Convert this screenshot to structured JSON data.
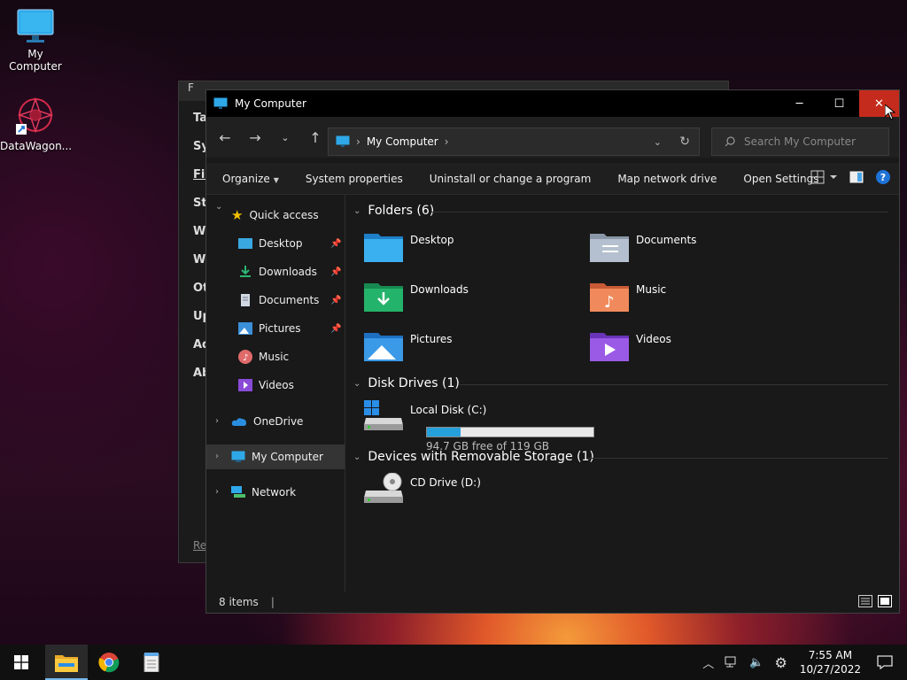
{
  "desktop": {
    "icons": [
      {
        "label": "My Computer",
        "icon": "computer-icon"
      },
      {
        "label": "DataWagon...",
        "icon": "datawagon-shortcut-icon"
      }
    ]
  },
  "back_window": {
    "title": "F",
    "side_labels": [
      "Tas",
      "Sy",
      "Fil",
      "Sta",
      "Wi",
      "Wo",
      "Ot",
      "Up",
      "Ad",
      "Ab"
    ],
    "link": "Re"
  },
  "window": {
    "title": "My Computer",
    "controls": {
      "minimize": "─",
      "maximize": "☐",
      "close": "✕"
    },
    "address": {
      "crumbs": [
        "My Computer"
      ]
    },
    "search": {
      "placeholder": "Search My Computer"
    },
    "commands": [
      {
        "label": "Organize",
        "dropdown": true
      },
      {
        "label": "System properties",
        "dropdown": false
      },
      {
        "label": "Uninstall or change a program",
        "dropdown": false
      },
      {
        "label": "Map network drive",
        "dropdown": false
      },
      {
        "label": "Open Settings",
        "dropdown": false
      }
    ],
    "help": "?",
    "sidebar": {
      "quick_access": "Quick access",
      "items": [
        {
          "label": "Desktop",
          "icon": "desktop-folder-icon",
          "pinned": true
        },
        {
          "label": "Downloads",
          "icon": "downloads-folder-icon",
          "pinned": true
        },
        {
          "label": "Documents",
          "icon": "documents-folder-icon",
          "pinned": true
        },
        {
          "label": "Pictures",
          "icon": "pictures-folder-icon",
          "pinned": true
        },
        {
          "label": "Music",
          "icon": "music-folder-icon",
          "pinned": false
        },
        {
          "label": "Videos",
          "icon": "videos-folder-icon",
          "pinned": false
        }
      ],
      "onedrive": "OneDrive",
      "my_computer": "My Computer",
      "network": "Network"
    },
    "groups": {
      "folders": {
        "title": "Folders (6)",
        "items": [
          "Desktop",
          "Documents",
          "Downloads",
          "Music",
          "Pictures",
          "Videos"
        ]
      },
      "disks": {
        "title": "Disk Drives (1)",
        "items": [
          {
            "name": "Local Disk (C:)",
            "free": "94.7 GB free of 119 GB",
            "used_fraction": 0.2
          }
        ]
      },
      "removable": {
        "title": "Devices with Removable Storage (1)",
        "items": [
          {
            "name": "CD Drive (D:)"
          }
        ]
      }
    },
    "status": {
      "items": "8 items"
    }
  },
  "taskbar": {
    "apps": [
      "start-button",
      "file-explorer",
      "chrome",
      "notepad"
    ],
    "tray": {
      "time": "7:55 AM",
      "date": "10/27/2022"
    }
  },
  "colors": {
    "accent": "#26a0da",
    "close": "#c42b1c",
    "taskbar": "#101010"
  }
}
